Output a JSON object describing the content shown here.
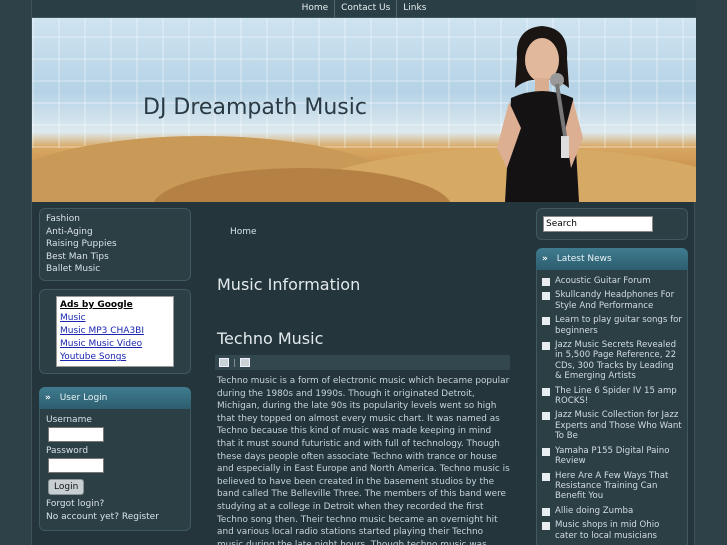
{
  "topnav": {
    "items": [
      "Home",
      "Contact Us",
      "Links"
    ]
  },
  "header": {
    "site_title": "DJ Dreampath Music"
  },
  "left_nav": {
    "links": [
      "Fashion",
      "Anti-Aging",
      "Raising Puppies",
      "Best Man Tips",
      "Ballet Music"
    ]
  },
  "ads": {
    "title": "Ads by Google",
    "links": [
      "Music",
      "Music MP3 CHA3BI",
      "Music Music Video",
      "Youtube Songs"
    ]
  },
  "login": {
    "title": "User Login",
    "username_label": "Username",
    "username_value": "",
    "password_label": "Password",
    "password_value": "",
    "button_label": "Login",
    "forgot_link": "Forgot login?",
    "register_link": "No account yet? Register"
  },
  "main": {
    "breadcrumb": "Home",
    "section_title": "Music Information",
    "article_title": "Techno Music",
    "article_body": "Techno music is a form of electronic music which became popular during the 1980s and 1990s. Though it originated Detroit, Michigan, during the late 90s its popularity levels went so high that they topped on almost every music chart. It was named as Techno because this kind of music was made keeping in mind that it must sound futuristic and with full of technology. Though these days people often associate Techno with trance or house and especially in East Europe and North America. Techno music is believed to have been created in the basement studios by the band called The Belleville Three. The members of this band were studying at a college in Detroit when they recorded the first Techno song then. Their techno music became an overnight hit and various local radio stations started playing their Techno music during the late night hours. Though techno music was initially perceived to be as purely party music,"
  },
  "search": {
    "value": "Search"
  },
  "latest_news": {
    "title": "Latest News",
    "items": [
      "Acoustic Guitar Forum",
      "Skullcandy Headphones For Style And Performance",
      "Learn to play guitar songs for beginners",
      "Jazz Music Secrets Revealed in 5,500 Page Reference, 22 CDs, 300 Tracks by Leading & Emerging Artists",
      "The Line 6 Spider IV 15 amp ROCKS!",
      "Jazz Music Collection for Jazz Experts and Those Who Want To Be",
      "Yamaha P155 Digital Paino Review",
      "Here Are A Few Ways That Resistance Training Can Benefit You",
      "Allie doing Zumba",
      "Music shops in mid Ohio cater to local musicians"
    ]
  },
  "icons": {
    "print": "print-icon",
    "email": "email-icon",
    "chevron": "double-chevron-icon"
  }
}
